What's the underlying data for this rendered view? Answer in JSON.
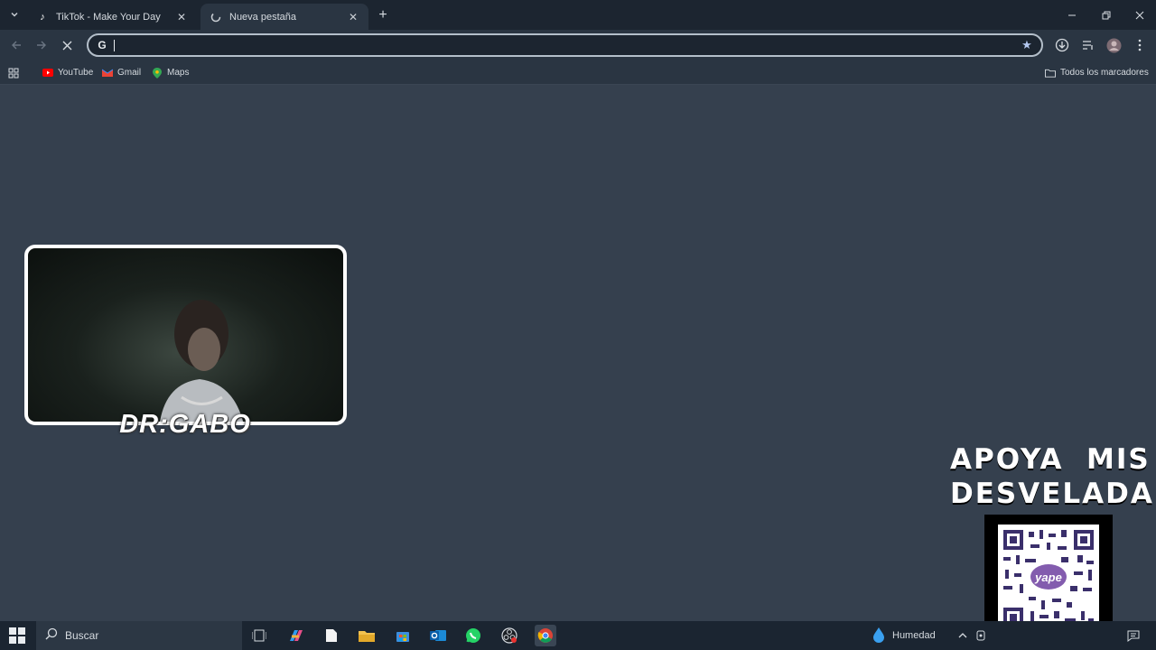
{
  "tabs": [
    {
      "title": "TikTok - Make Your Day",
      "active": false
    },
    {
      "title": "Nueva pestaña",
      "active": true
    }
  ],
  "omnibox": {
    "value": "",
    "placeholder": ""
  },
  "bookmarks": [
    {
      "label": "YouTube",
      "icon": "youtube-icon",
      "color": "#ff0000"
    },
    {
      "label": "Gmail",
      "icon": "gmail-icon",
      "color": "#ea4335"
    },
    {
      "label": "Maps",
      "icon": "maps-icon",
      "color": "#34a853"
    }
  ],
  "all_bookmarks_label": "Todos los marcadores",
  "overlay": {
    "streamer_name": "DR:GABO",
    "promo_line1": "APOYA  MIS",
    "promo_line2": "DESVELADAS",
    "qr_label": "yape"
  },
  "taskbar": {
    "search_label": "Buscar",
    "weather_label": "Humedad"
  },
  "colors": {
    "page_bg": "#35404e",
    "tabstrip_bg": "#1c2530",
    "toolbar_bg": "#2a3542",
    "taskbar_bg": "#1b2531"
  }
}
